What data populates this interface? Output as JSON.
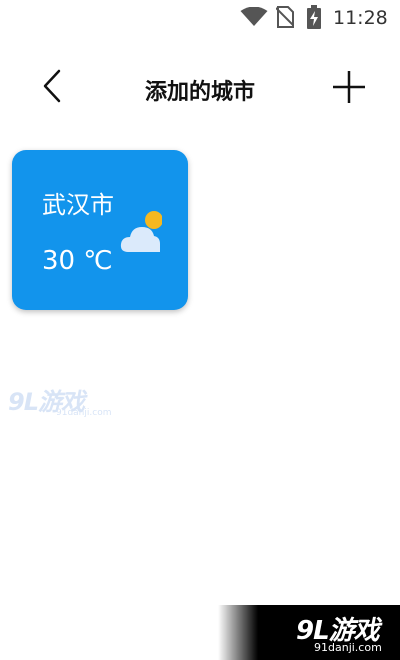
{
  "status_bar": {
    "time": "11:28",
    "icons": [
      "wifi-icon",
      "no-sim-icon",
      "battery-charging-icon"
    ]
  },
  "header": {
    "title": "添加的城市",
    "back_icon": "chevron-left-icon",
    "add_icon": "plus-icon"
  },
  "cities": [
    {
      "name": "武汉市",
      "temperature": "30 ℃",
      "weather_icon": "partly-cloudy-icon"
    }
  ],
  "colors": {
    "card_background": "#1294ec",
    "card_text": "#ffffff",
    "page_background": "#ffffff"
  },
  "watermarks": {
    "middle": {
      "brand": "9L游戏",
      "url": "91danji.com"
    },
    "corner": {
      "brand": "9L游戏",
      "url": "91danji.com"
    }
  }
}
